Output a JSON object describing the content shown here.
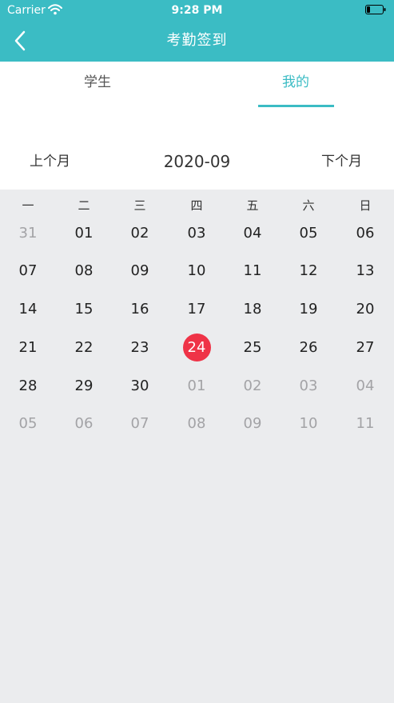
{
  "status": {
    "carrier": "Carrier",
    "time": "9:28 PM"
  },
  "nav": {
    "title": "考勤签到"
  },
  "tabs": [
    {
      "label": "学生"
    },
    {
      "label": "我的"
    }
  ],
  "month_nav": {
    "prev": "上个月",
    "current": "2020-09",
    "next": "下个月"
  },
  "calendar": {
    "weekdays": [
      "一",
      "二",
      "三",
      "四",
      "五",
      "六",
      "日"
    ],
    "rows": [
      [
        "31",
        "01",
        "02",
        "03",
        "04",
        "05",
        "06"
      ],
      [
        "07",
        "08",
        "09",
        "10",
        "11",
        "12",
        "13"
      ],
      [
        "14",
        "15",
        "16",
        "17",
        "18",
        "19",
        "20"
      ],
      [
        "21",
        "22",
        "23",
        "24",
        "25",
        "26",
        "27"
      ],
      [
        "28",
        "29",
        "30",
        "01",
        "02",
        "03",
        "04"
      ],
      [
        "05",
        "06",
        "07",
        "08",
        "09",
        "10",
        "11"
      ]
    ]
  },
  "colors": {
    "accent": "#3bbcc4",
    "today": "#ef3347",
    "muted_text": "#a3a3a6",
    "calendar_bg": "#ebecee"
  }
}
